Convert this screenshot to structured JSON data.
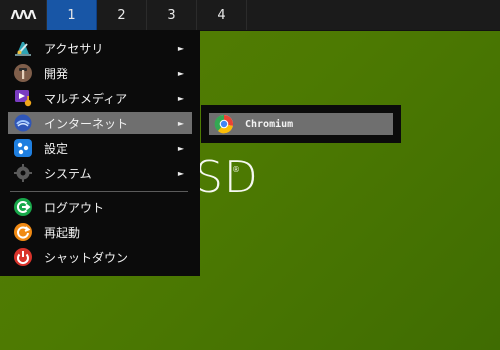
{
  "panel": {
    "logo": "ΛΛΛ",
    "workspaces": [
      {
        "label": "1",
        "active": true
      },
      {
        "label": "2",
        "active": false
      },
      {
        "label": "3",
        "active": false
      },
      {
        "label": "4",
        "active": false
      }
    ]
  },
  "wallpaper": {
    "text": "SD",
    "registered": "®"
  },
  "menu": {
    "items": [
      {
        "label": "アクセサリ",
        "icon": "accessories-icon",
        "has_submenu": true
      },
      {
        "label": "開発",
        "icon": "development-hammer-icon",
        "has_submenu": true
      },
      {
        "label": "マルチメディア",
        "icon": "multimedia-icon",
        "has_submenu": true
      },
      {
        "label": "インターネット",
        "icon": "internet-globe-icon",
        "has_submenu": true,
        "selected": true
      },
      {
        "label": "設定",
        "icon": "settings-icon",
        "has_submenu": true
      },
      {
        "label": "システム",
        "icon": "system-gear-icon",
        "has_submenu": true
      },
      {
        "label": "ログアウト",
        "icon": "logout-icon",
        "has_submenu": false
      },
      {
        "label": "再起動",
        "icon": "restart-icon",
        "has_submenu": false
      },
      {
        "label": "シャットダウン",
        "icon": "power-icon",
        "has_submenu": false
      }
    ],
    "arrow": "►"
  },
  "submenu": {
    "items": [
      {
        "label": "Chromium",
        "icon": "chromium-icon",
        "selected": true
      }
    ]
  },
  "colors": {
    "panel": "#1b1b1b",
    "active_workspace": "#1856a6",
    "menu_background": "#0b0b0b",
    "selection": "#6f6f6f",
    "wallpaper": "#4f7c03"
  }
}
